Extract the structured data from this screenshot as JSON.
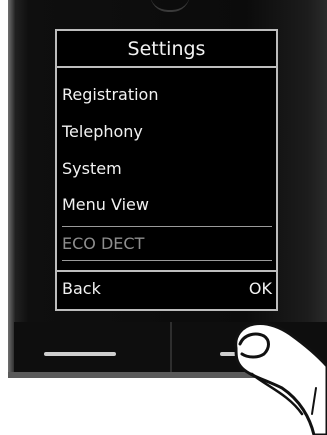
{
  "screen": {
    "title": "Settings",
    "menu_items": [
      {
        "label": "Registration",
        "enabled": true
      },
      {
        "label": "Telephony",
        "enabled": true
      },
      {
        "label": "System",
        "enabled": true
      },
      {
        "label": "Menu View",
        "enabled": true
      },
      {
        "label": "ECO DECT",
        "enabled": false
      }
    ],
    "softkeys": {
      "left": "Back",
      "right": "OK"
    }
  },
  "colors": {
    "screen_background": "#000000",
    "text": "#f2f2f2",
    "disabled_text": "#8e8e8e",
    "frame": "#bdbdbd"
  }
}
